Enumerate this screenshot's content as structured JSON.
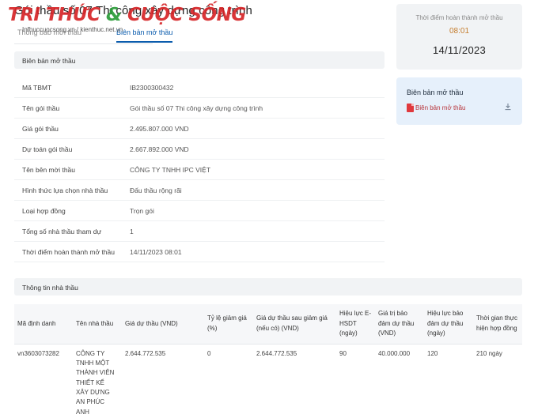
{
  "header": {
    "title": "Gói thầu số 07 Thi công xây dựng công trình",
    "watermark_brand": "TRI THỨC & CUỘC SỐNG",
    "watermark_url": "Infhuccuocsong.vn / kienthuc.net.vn",
    "tabs": [
      {
        "label": "Thông báo mời thầu",
        "active": false
      },
      {
        "label": "Biên bản mở thầu",
        "active": true
      }
    ]
  },
  "opening_section": {
    "title": "Biên bản mở thầu",
    "rows": [
      {
        "label": "Mã TBMT",
        "value": "IB2300300432"
      },
      {
        "label": "Tên gói thầu",
        "value": "Gói thầu số 07 Thi công xây dựng công trình"
      },
      {
        "label": "Giá gói thầu",
        "value": "2.495.807.000 VND"
      },
      {
        "label": "Dự toán gói thầu",
        "value": "2.667.892.000 VND"
      },
      {
        "label": "Tên bên mời thầu",
        "value": "CÔNG TY TNHH IPC VIỆT"
      },
      {
        "label": "Hình thức lựa chọn nhà thầu",
        "value": "Đấu thầu rộng rãi"
      },
      {
        "label": "Loại hợp đồng",
        "value": "Trọn gói"
      },
      {
        "label": "Tổng số nhà thầu tham dự",
        "value": "1"
      },
      {
        "label": "Thời điểm hoàn thành mở thầu",
        "value": "14/11/2023 08:01"
      }
    ]
  },
  "time_card": {
    "label": "Thời điểm hoàn thành mở thầu",
    "hour": "08:01",
    "date": "14/11/2023"
  },
  "doc_card": {
    "title": "Biên bản mở thầu",
    "link_label": "Biên bản mở thầu",
    "file_icon": "pdf-icon",
    "action_icon": "download-icon"
  },
  "contractor_section": {
    "title": "Thông tin nhà thầu",
    "columns": [
      "Mã định danh",
      "Tên nhà thầu",
      "Giá dự thầu (VND)",
      "Tỷ lệ giảm giá (%)",
      "Giá dự thầu sau giảm giá (nếu có) (VND)",
      "Hiệu lực E-HSDT (ngày)",
      "Giá trị bảo đảm dự thầu (VND)",
      "Hiệu lực bảo đảm dự thầu (ngày)",
      "Thời gian thực hiện hợp đồng"
    ],
    "rows": [
      {
        "id": "vn3603073282",
        "name": "CÔNG TY TNHH MỘT THÀNH VIÊN THIẾT KẾ XÂY DỰNG AN PHÚC ANH",
        "bid_price": "2.644.772.535",
        "discount": "0",
        "bid_after_discount": "2.644.772.535",
        "validity": "90",
        "guarantee_value": "40.000.000",
        "guarantee_validity": "120",
        "duration": "210 ngày"
      }
    ]
  },
  "colors": {
    "accent": "#0b5cad",
    "watermark_red": "#d62528",
    "time_hour": "#c57d2e",
    "panel_bg": "#f1f3f5",
    "doc_card_bg": "#e6f0fb"
  }
}
